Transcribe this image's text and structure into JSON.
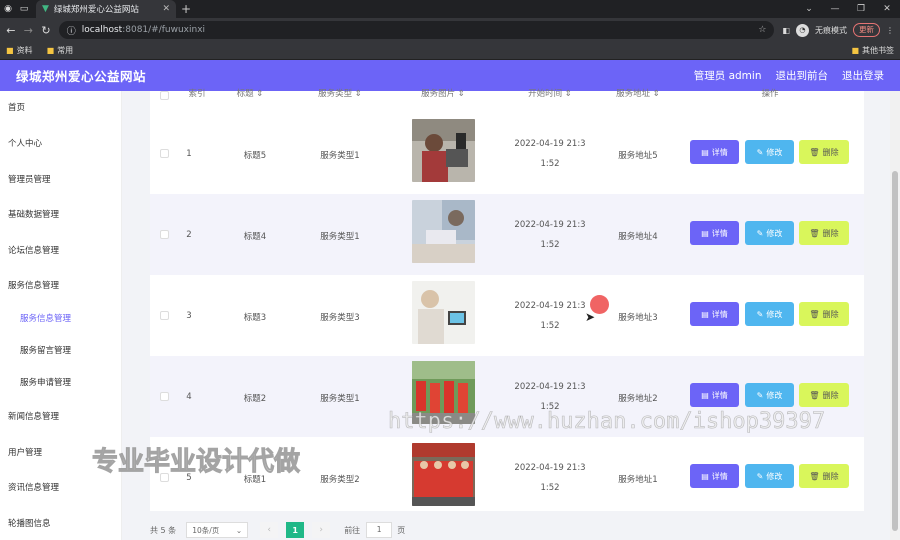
{
  "browser": {
    "tab_title": "绿城郑州爱心公益网站",
    "url_host": "localhost",
    "url_path": ":8081/#/fuwuxinxi",
    "incognito_label": "无痕模式",
    "update_label": "更新",
    "bookmarks": [
      "资料",
      "常用"
    ],
    "other_bookmarks": "其他书签"
  },
  "app": {
    "title": "绿城郑州爱心公益网站",
    "admin": "管理员 admin",
    "to_front": "退出到前台",
    "logout": "退出登录",
    "accent": "#6c64f7"
  },
  "sidebar": {
    "items": [
      {
        "label": "首页"
      },
      {
        "label": "个人中心"
      },
      {
        "label": "管理员管理"
      },
      {
        "label": "基础数据管理"
      },
      {
        "label": "论坛信息管理"
      },
      {
        "label": "服务信息管理"
      },
      {
        "label": "服务信息管理"
      },
      {
        "label": "服务留言管理"
      },
      {
        "label": "服务申请管理"
      },
      {
        "label": "新闻信息管理"
      },
      {
        "label": "用户管理"
      },
      {
        "label": "资讯信息管理"
      },
      {
        "label": "轮播图信息"
      }
    ]
  },
  "table": {
    "headers": [
      "索引",
      "标题",
      "服务类型",
      "服务图片",
      "开始时间",
      "服务地址",
      "操作"
    ],
    "buttons": {
      "detail": "详情",
      "edit": "修改",
      "delete": "删除"
    },
    "rows": [
      {
        "index": "1",
        "title": "标题5",
        "type": "服务类型1",
        "time1": "2022-04-19 21:3",
        "time2": "1:52",
        "address": "服务地址5"
      },
      {
        "index": "2",
        "title": "标题4",
        "type": "服务类型1",
        "time1": "2022-04-19 21:3",
        "time2": "1:52",
        "address": "服务地址4"
      },
      {
        "index": "3",
        "title": "标题3",
        "type": "服务类型3",
        "time1": "2022-04-19 21:3",
        "time2": "1:52",
        "address": "服务地址3"
      },
      {
        "index": "4",
        "title": "标题2",
        "type": "服务类型1",
        "time1": "2022-04-19 21:3",
        "time2": "1:52",
        "address": "服务地址2"
      },
      {
        "index": "5",
        "title": "标题1",
        "type": "服务类型2",
        "time1": "2022-04-19 21:3",
        "time2": "1:52",
        "address": "服务地址1"
      }
    ]
  },
  "pager": {
    "total": "共 5 条",
    "page_size": "10条/页",
    "current": "1",
    "goto_label": "前往",
    "goto_value": "1",
    "page_suffix": "页"
  },
  "watermarks": {
    "url": "https://www.huzhan.com/ishop39397",
    "text": "专业毕业设计代做"
  }
}
